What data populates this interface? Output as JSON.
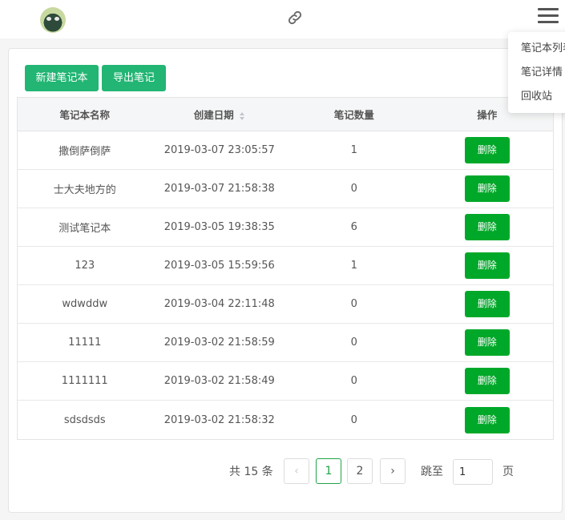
{
  "header": {
    "avatar_icon": "frog-avatar-icon",
    "link_icon": "link-icon",
    "menu_icon": "hamburger-menu-icon"
  },
  "dropdown": {
    "items": [
      {
        "label": "笔记本列表"
      },
      {
        "label": "笔记详情"
      },
      {
        "label": "回收站"
      }
    ]
  },
  "toolbar": {
    "new_label": "新建笔记本",
    "export_label": "导出笔记"
  },
  "table": {
    "headers": {
      "name": "笔记本名称",
      "date": "创建日期",
      "count": "笔记数量",
      "actions": "操作"
    },
    "sort_icon": "sort-arrows-icon",
    "rows": [
      {
        "name": "撒倒萨倒萨",
        "date": "2019-03-07 23:05:57",
        "count": "1",
        "action": "删除"
      },
      {
        "name": "士大夫地方的",
        "date": "2019-03-07 21:58:38",
        "count": "0",
        "action": "删除"
      },
      {
        "name": "测试笔记本",
        "date": "2019-03-05 19:38:35",
        "count": "6",
        "action": "删除"
      },
      {
        "name": "123",
        "date": "2019-03-05 15:59:56",
        "count": "1",
        "action": "删除"
      },
      {
        "name": "wdwddw",
        "date": "2019-03-04 22:11:48",
        "count": "0",
        "action": "删除"
      },
      {
        "name": "11111",
        "date": "2019-03-02 21:58:59",
        "count": "0",
        "action": "删除"
      },
      {
        "name": "1111111",
        "date": "2019-03-02 21:58:49",
        "count": "0",
        "action": "删除"
      },
      {
        "name": "sdsdsds",
        "date": "2019-03-02 21:58:32",
        "count": "0",
        "action": "删除"
      }
    ]
  },
  "pagination": {
    "total_label": "共 15 条",
    "prev": "‹",
    "pages": [
      "1",
      "2"
    ],
    "next": "›",
    "jump_label": "跳至",
    "jump_value": "1",
    "page_suffix": "页"
  },
  "colors": {
    "primary_button": "#22b573",
    "delete_button": "#00a829",
    "active_page": "#22a34a"
  }
}
